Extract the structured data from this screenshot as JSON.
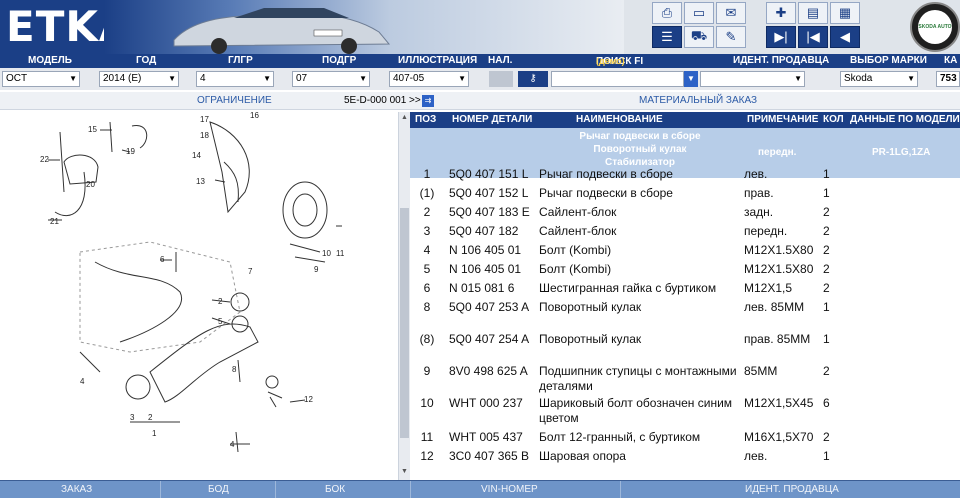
{
  "app": {
    "brand": "ETKA",
    "logo_text": "SKODA AUTO"
  },
  "columns": {
    "model": "МОДЕЛЬ",
    "year": "ГОД",
    "main_group": "ГЛГР",
    "sub_group": "ПОДГР",
    "illustration": "ИЛЛЮСТРАЦИЯ",
    "nal": "НАЛ.",
    "search": "ПОИСК FI",
    "demo": "(демо)",
    "dealer_id": "ИДЕНТ. ПРОДАВЦА",
    "brand_select": "ВЫБОР МАРКИ",
    "cat": "КА"
  },
  "selectors": {
    "model": "OCT",
    "year": "2014 (E)",
    "main_group": "4",
    "sub_group": "07",
    "illustration": "407-05",
    "search_value": "",
    "dealer_value": "",
    "brand": "Skoda",
    "cat": "753"
  },
  "section": {
    "restriction": "ОГРАНИЧЕНИЕ",
    "ref": "5E-D-000 001 >>",
    "material_order": "МАТЕРИАЛЬНЫЙ ЗАКАЗ"
  },
  "table": {
    "headers": {
      "pos": "ПОЗ",
      "part_no": "НОМЕР ДЕТАЛИ",
      "name": "НАИМЕНОВАНИЕ",
      "note": "ПРИМЕЧАНИЕ",
      "qty": "КОЛ",
      "model_data": "ДАННЫЕ ПО МОДЕЛИ"
    },
    "subheader": {
      "lines": [
        "Рычаг подвески в сборе",
        "Поворотный кулак",
        "Стабилизатор"
      ],
      "note": "передн.",
      "model": "PR-1LG,1ZA"
    },
    "rows": [
      {
        "pos": "1",
        "num": "5Q0 407 151 L",
        "name": "Рычаг подвески в сборе",
        "note": "лев.",
        "qty": "1"
      },
      {
        "pos": "(1)",
        "num": "5Q0 407 152 L",
        "name": "Рычаг подвески в сборе",
        "note": "прав.",
        "qty": "1"
      },
      {
        "pos": "2",
        "num": "5Q0 407 183 E",
        "name": "Сайлент-блок",
        "note": "задн.",
        "qty": "2"
      },
      {
        "pos": "3",
        "num": "5Q0 407 182",
        "name": "Сайлент-блок",
        "note": "передн.",
        "qty": "2"
      },
      {
        "pos": "4",
        "num": "N   106 405 01",
        "name": "Болт (Kombi)",
        "note": "M12X1.5X80",
        "qty": "2"
      },
      {
        "pos": "5",
        "num": "N   106 405 01",
        "name": "Болт (Kombi)",
        "note": "M12X1.5X80",
        "qty": "2"
      },
      {
        "pos": "6",
        "num": "N   015 081 6",
        "name": "Шестигранная гайка с буртиком",
        "note": "M12X1,5",
        "qty": "2"
      },
      {
        "pos": "8",
        "num": "5Q0 407 253 A",
        "name": "Поворотный кулак",
        "note": "лев. 85MM",
        "qty": "1"
      },
      {
        "pos": "(8)",
        "num": "5Q0 407 254 A",
        "name": "Поворотный кулак",
        "note": "прав. 85MM",
        "qty": "1"
      },
      {
        "pos": "9",
        "num": "8V0 498 625 A",
        "name": "Подшипник ступицы с монтажными деталями",
        "note": "85MM",
        "qty": "2"
      },
      {
        "pos": "10",
        "num": "WHT 000 237",
        "name": "Шариковый болт обозначен синим цветом",
        "note": "M12X1,5X45",
        "qty": "6"
      },
      {
        "pos": "11",
        "num": "WHT 005 437",
        "name": "Болт 12-гранный, с буртиком",
        "note": "M16X1,5X70",
        "qty": "2"
      },
      {
        "pos": "12",
        "num": "3C0 407 365 B",
        "name": "Шаровая опора",
        "note": "лев.",
        "qty": "1"
      }
    ]
  },
  "illustration_labels": [
    "15",
    "17",
    "18",
    "16",
    "19",
    "22",
    "20",
    "14",
    "13",
    "21",
    "10",
    "11",
    "9",
    "6",
    "7",
    "2",
    "5",
    "4",
    "8",
    "12",
    "3",
    "2",
    "1",
    "4"
  ],
  "footer": {
    "order": "ЗАКАЗ",
    "side": "БОД",
    "bok": "БОК",
    "vin": "VIN-НОМЕР",
    "dealer": "ИДЕНТ. ПРОДАВЦА"
  }
}
